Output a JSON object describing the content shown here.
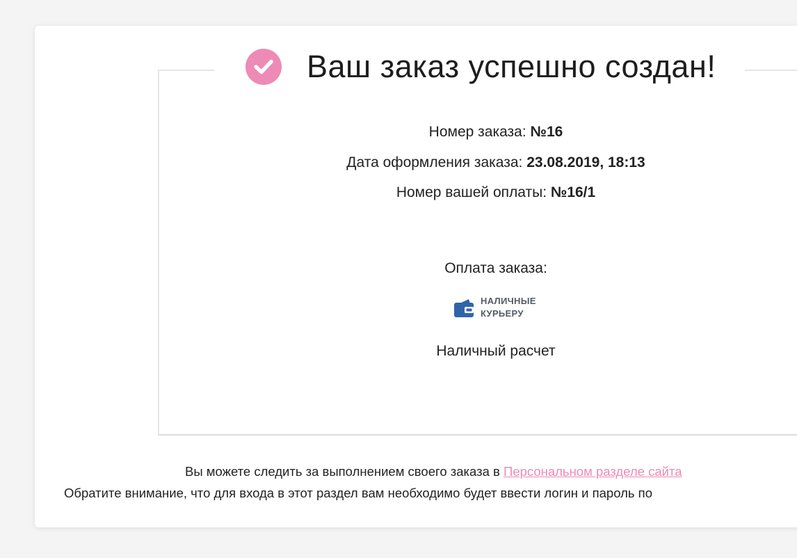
{
  "theme": {
    "accent": "#ee8ab6",
    "wallet_blue": "#2f65a8"
  },
  "header": {
    "icon": "check-circle-icon",
    "title": "Ваш заказ успешно создан!"
  },
  "order": {
    "number_label": "Номер заказа:",
    "number_value": "№16",
    "date_label": "Дата оформления заказа:",
    "date_value": "23.08.2019, 18:13",
    "payment_number_label": "Номер вашей оплаты:",
    "payment_number_value": "№16/1"
  },
  "payment": {
    "label": "Оплата заказа:",
    "icon": "wallet-icon",
    "logo_line1": "НАЛИЧНЫЕ",
    "logo_line2": "КУРЬЕРУ",
    "method_name": "Наличный расчет"
  },
  "footer": {
    "tracking_text": "Вы можете следить за выполнением своего заказа в",
    "personal_section_link": "Персональном разделе сайта",
    "login_notice": "Обратите внимание, что для входа в этот раздел вам необходимо будет ввести логин и пароль по"
  }
}
